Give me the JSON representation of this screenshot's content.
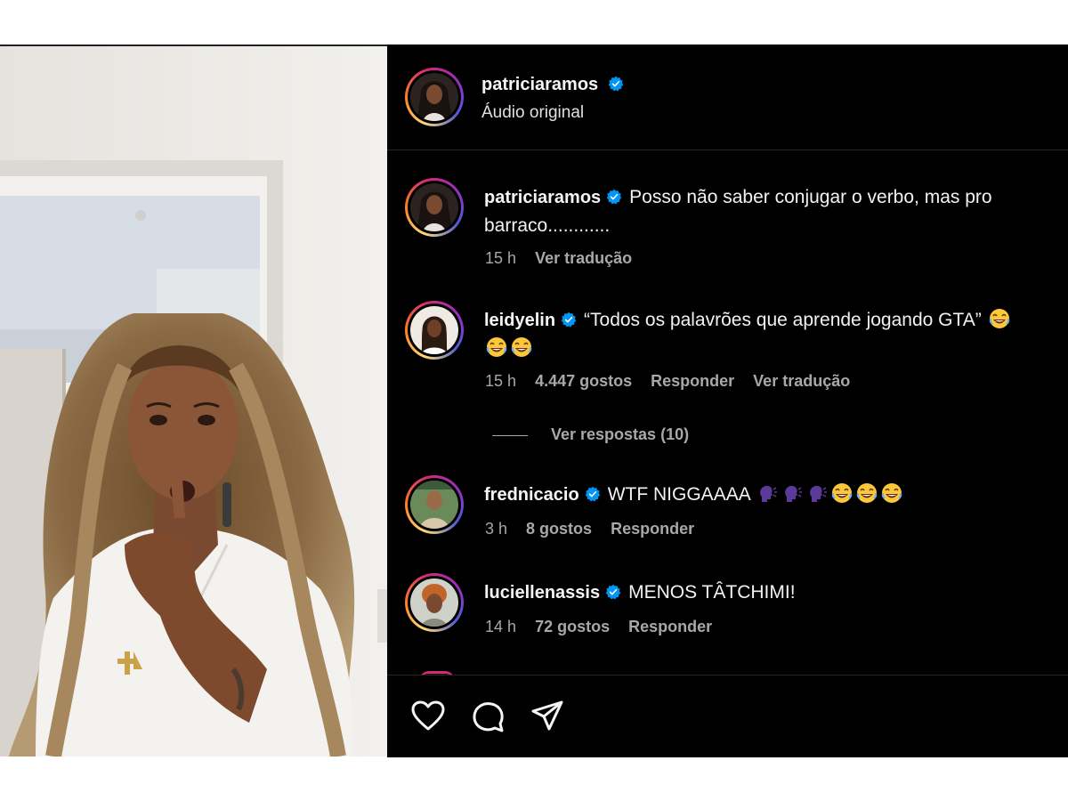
{
  "post": {
    "username": "patriciaramos",
    "subtitle": "Áudio original"
  },
  "comments": [
    {
      "username": "patriciaramos",
      "text": "Posso não saber conjugar o verbo, mas pro barraco............",
      "time": "15 h",
      "likes": "",
      "reply": "",
      "translate": "Ver tradução"
    },
    {
      "username": "leidyelin",
      "text": "“Todos os palavrões que aprende jogando GTA”",
      "time": "15 h",
      "likes": "4.447 gostos",
      "reply": "Responder",
      "translate": "Ver tradução",
      "view_replies": "Ver respostas (10)"
    },
    {
      "username": "frednicacio",
      "text": "WTF NIGGAAAA",
      "time": "3 h",
      "likes": "8 gostos",
      "reply": "Responder"
    },
    {
      "username": "luciellenassis",
      "text": "MENOS TÂTCHIMI!",
      "time": "14 h",
      "likes": "72 gostos",
      "reply": "Responder"
    }
  ],
  "footer_icons": [
    "heart-icon",
    "comment-icon",
    "share-icon"
  ],
  "colors": {
    "background": "#000000",
    "text": "#f5f5f5",
    "muted": "#a8a8a8",
    "verified": "#0095f6"
  }
}
